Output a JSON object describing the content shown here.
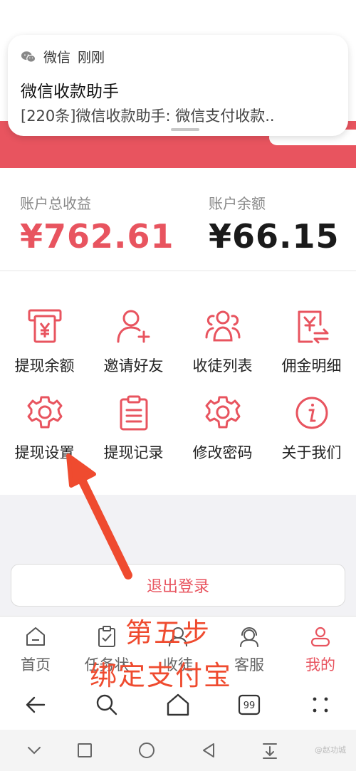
{
  "notification": {
    "app_name": "微信",
    "time": "刚刚",
    "title": "微信收款助手",
    "body": "[220条]微信收款助手: 微信支付收款.."
  },
  "stats": {
    "total_label": "账户总收益",
    "total_value": "¥762.61",
    "balance_label": "账户余额",
    "balance_value": "¥66.15"
  },
  "grid": [
    {
      "label": "提现余额",
      "icon": "atm-yen-icon"
    },
    {
      "label": "邀请好友",
      "icon": "user-add-icon"
    },
    {
      "label": "收徒列表",
      "icon": "group-icon"
    },
    {
      "label": "佣金明细",
      "icon": "commission-transfer-icon"
    },
    {
      "label": "提现设置",
      "icon": "gear-icon"
    },
    {
      "label": "提现记录",
      "icon": "clipboard-list-icon"
    },
    {
      "label": "修改密码",
      "icon": "gear-icon"
    },
    {
      "label": "关于我们",
      "icon": "info-icon"
    }
  ],
  "logout_label": "退出登录",
  "tabs": [
    {
      "label": "首页",
      "icon": "home-icon"
    },
    {
      "label": "任务状",
      "icon": "clipboard-check-icon"
    },
    {
      "label": "收徒",
      "icon": "user-icon"
    },
    {
      "label": "客服",
      "icon": "headset-icon"
    },
    {
      "label": "我的",
      "icon": "user-icon",
      "active": true
    }
  ],
  "nav": {
    "history_count": "99"
  },
  "watermark": "@赵功城",
  "annotation": {
    "line1": "第五步",
    "line2": "绑定支付宝"
  },
  "colors": {
    "accent": "#e8545f",
    "annotation": "#ef4b2f"
  }
}
